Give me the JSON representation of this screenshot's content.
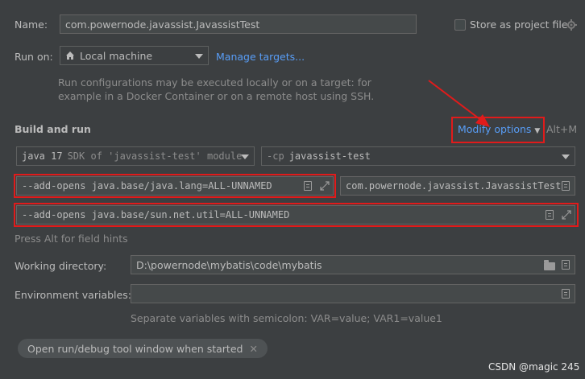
{
  "name": {
    "label": "Name:",
    "value": "com.powernode.javassist.JavassistTest"
  },
  "store": {
    "label": "Store as project file"
  },
  "run_on": {
    "label": "Run on:",
    "selected": "Local machine",
    "manage_link": "Manage targets...",
    "description_line1": "Run configurations may be executed locally or on a target: for",
    "description_line2": "example in a Docker Container or on a remote host using SSH."
  },
  "build_run": {
    "title": "Build and run",
    "modify_options": "Modify options",
    "modify_shortcut": "Alt+M",
    "jdk_main": "java 17",
    "jdk_sub": "SDK of 'javassist-test' module",
    "cp_prefix": "-cp",
    "cp_value": "javassist-test",
    "vm_options": "--add-opens java.base/java.lang=ALL-UNNAMED",
    "main_class": "com.powernode.javassist.JavassistTest",
    "program_args": "--add-opens java.base/sun.net.util=ALL-UNNAMED",
    "field_hint": "Press Alt for field hints"
  },
  "working_dir": {
    "label": "Working directory:",
    "value": "D:\\powernode\\mybatis\\code\\mybatis"
  },
  "env_vars": {
    "label": "Environment variables:",
    "value": "",
    "hint": "Separate variables with semicolon: VAR=value; VAR1=value1"
  },
  "open_tool_window": {
    "label": "Open run/debug tool window when started"
  },
  "watermark": "CSDN @magic 245",
  "colors": {
    "accent_link": "#589df6",
    "annotation_red": "#e01b1b",
    "background": "#3c3f41"
  },
  "icons": [
    "checkbox-icon",
    "gear-icon",
    "home-icon",
    "chevron-down-icon",
    "document-icon",
    "expand-icon",
    "folder-icon",
    "close-icon",
    "annotation-arrow"
  ]
}
